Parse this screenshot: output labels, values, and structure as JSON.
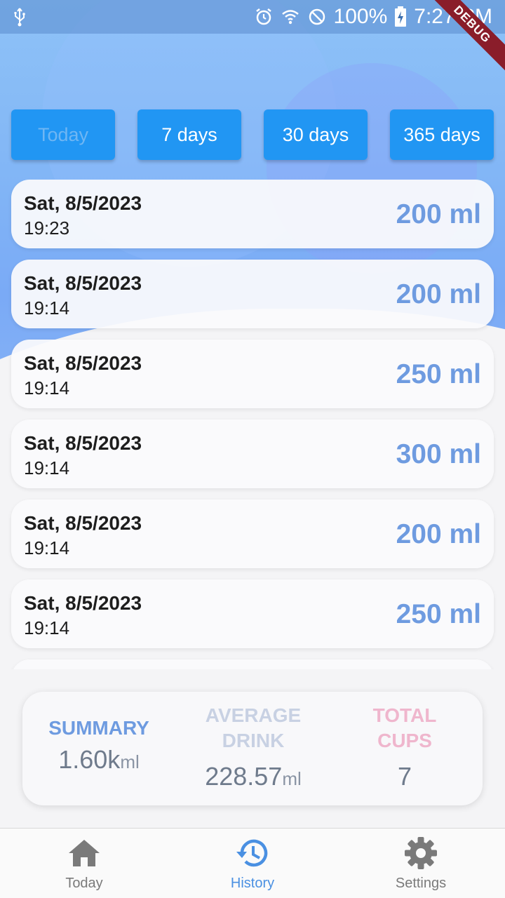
{
  "status_bar": {
    "battery": "100%",
    "time": "7:27 PM",
    "debug_label": "DEBUG"
  },
  "filters": [
    {
      "label": "Today",
      "disabled": true
    },
    {
      "label": "7 days",
      "disabled": false
    },
    {
      "label": "30 days",
      "disabled": false
    },
    {
      "label": "365 days",
      "disabled": false
    }
  ],
  "entries": [
    {
      "date": "Sat, 8/5/2023",
      "time": "19:23",
      "amount": "200 ml"
    },
    {
      "date": "Sat, 8/5/2023",
      "time": "19:14",
      "amount": "200 ml"
    },
    {
      "date": "Sat, 8/5/2023",
      "time": "19:14",
      "amount": "250 ml"
    },
    {
      "date": "Sat, 8/5/2023",
      "time": "19:14",
      "amount": "300 ml"
    },
    {
      "date": "Sat, 8/5/2023",
      "time": "19:14",
      "amount": "200 ml"
    },
    {
      "date": "Sat, 8/5/2023",
      "time": "19:14",
      "amount": "250 ml"
    }
  ],
  "summary": {
    "summary_label": "SUMMARY",
    "summary_value": "1.60k",
    "summary_unit": "ml",
    "average_label": "AVERAGE DRINK",
    "average_value": "228.57",
    "average_unit": "ml",
    "cups_label": "TOTAL CUPS",
    "cups_value": "7"
  },
  "colors": {
    "accent": "#2196f3",
    "amount": "#6e9be0",
    "summary_label": "#6e9be0",
    "average_label": "#c8d1e3",
    "cups_label": "#efb6cd",
    "nav_active": "#4a90e2",
    "nav_inactive": "#7a7a7a"
  },
  "nav": [
    {
      "label": "Today",
      "icon": "home-icon",
      "active": false
    },
    {
      "label": "History",
      "icon": "history-icon",
      "active": true
    },
    {
      "label": "Settings",
      "icon": "gear-icon",
      "active": false
    }
  ]
}
